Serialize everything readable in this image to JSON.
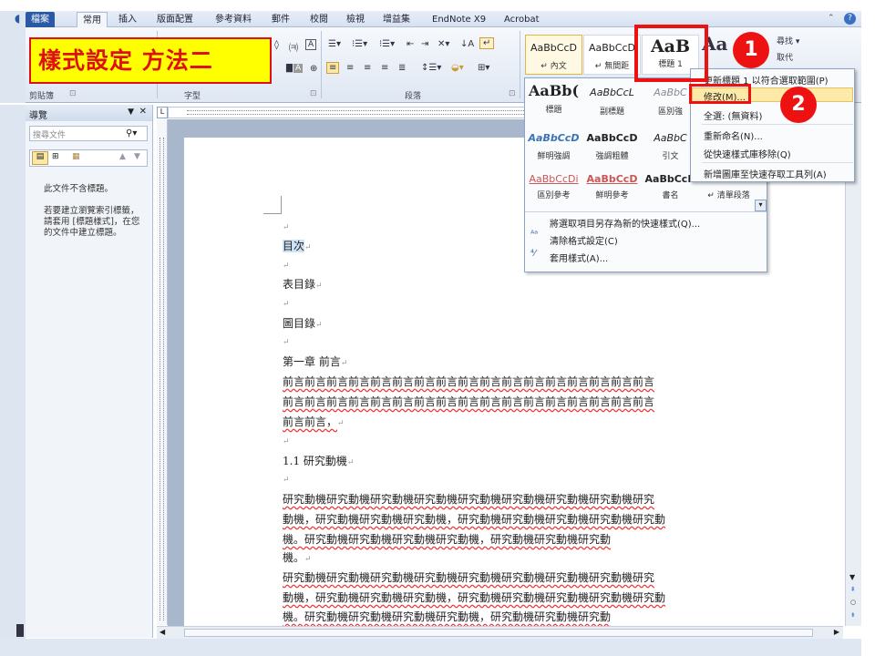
{
  "tabs": [
    {
      "label": "檔案"
    },
    {
      "label": "常用"
    },
    {
      "label": "插入"
    },
    {
      "label": "版面配置"
    },
    {
      "label": "參考資料"
    },
    {
      "label": "郵件"
    },
    {
      "label": "校閱"
    },
    {
      "label": "檢視"
    },
    {
      "label": "增益集"
    },
    {
      "label": "EndNote X9"
    },
    {
      "label": "Acrobat"
    }
  ],
  "annotation": {
    "title": "樣式設定 方法二",
    "badge1": "1",
    "badge2": "2"
  },
  "ribbon": {
    "groups": {
      "clipboard": "剪貼簿",
      "font": "字型",
      "paragraph": "段落"
    },
    "find": "尋找 ▾",
    "replace": "取代"
  },
  "styles_row1": [
    {
      "preview": "AaBbCcD",
      "name": "↵ 內文"
    },
    {
      "preview": "AaBbCcD",
      "name": "↵ 無間距"
    },
    {
      "preview": "AaB",
      "name": "標題 1"
    }
  ],
  "styles_grid": [
    [
      {
        "preview": "AaBb(",
        "name": "標題"
      },
      {
        "preview": "AaBbCcL",
        "name": "副標題"
      },
      {
        "preview": "AaBbC",
        "name": "區別強"
      }
    ],
    [
      {
        "preview": "AaBbCcD",
        "name": "鮮明強調"
      },
      {
        "preview": "AaBbCcD",
        "name": "強調粗體"
      },
      {
        "preview": "AaBbC",
        "name": "引文"
      }
    ],
    [
      {
        "preview": "AaBbCcDi",
        "name": "區別參考"
      },
      {
        "preview": "AaBbCcD",
        "name": "鮮明參考"
      },
      {
        "preview": "AaBbCcD",
        "name": "書名"
      },
      {
        "preview": "AaBbCcD",
        "name": "↵ 清單段落"
      }
    ]
  ],
  "dropdown_menu": [
    {
      "label": "將選取項目另存為新的快速樣式(Q)..."
    },
    {
      "label": "清除格式設定(C)"
    },
    {
      "label": "套用樣式(A)..."
    }
  ],
  "context_menu": [
    {
      "label": "更新標題 1 以符合選取範圍(P)"
    },
    {
      "label": "修改(M)..."
    },
    {
      "label": "全選: (無資料)"
    },
    {
      "label": "重新命名(N)..."
    },
    {
      "label": "從快速樣式庫移除(Q)"
    },
    {
      "label": "新增圖庫至快速存取工具列(A)"
    }
  ],
  "nav": {
    "title": "導覽",
    "search_placeholder": "搜尋文件",
    "msg1": "此文件不含標題。",
    "msg2": "若要建立瀏覽索引標籤，請套用 [標題樣式]，在您的文件中建立標題。"
  },
  "doc": {
    "toc": "目次",
    "tables": "表目錄",
    "figures": "圖目錄",
    "ch1": "第一章 前言",
    "intro1": "前言前言前言前言前言前言前言前言前言前言前言前言前言前言前言前言前言",
    "intro2": "前言前言前言前言前言前言前言前言前言前言前言前言前言前言前言前言前言",
    "intro3": "前言前言，",
    "sec11": "1.1 研究動機",
    "m1": "研究動機研究動機研究動機研究動機研究動機研究動機研究動機研究動機研究",
    "m2": "動機，研究動機研究動機研究動機，研究動機研究動機研究動機研究動機研究動",
    "m3": "機。研究動機研究動機研究動機研究動機，研究動機研究動機研究動",
    "m4": "機。",
    "m5": "研究動機研究動機研究動機研究動機研究動機研究動機研究動機研究動機研究",
    "m6": "動機，研究動機研究動機研究動機，研究動機研究動機研究動機研究動機研究動",
    "m7": "機。研究動機研究動機研究動機研究動機，研究動機研究動機研究動"
  }
}
